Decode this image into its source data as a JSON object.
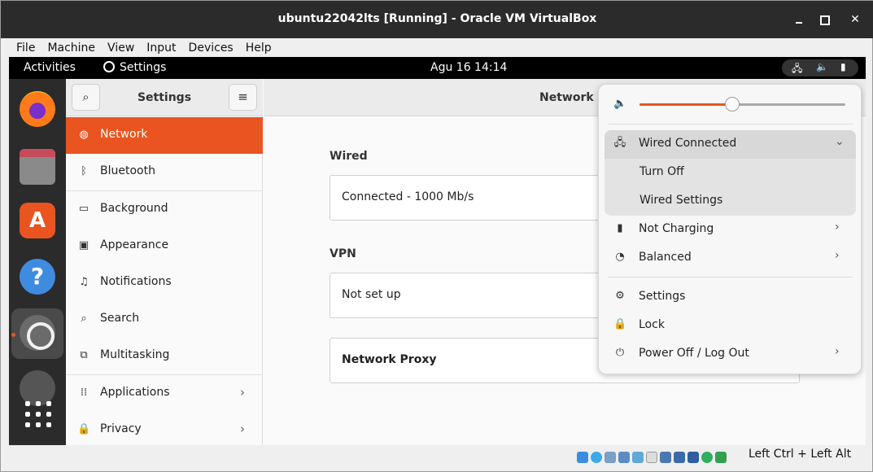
{
  "host": {
    "window_title": "ubuntu22042lts [Running] - Oracle VM VirtualBox",
    "menu": [
      "File",
      "Machine",
      "View",
      "Input",
      "Devices",
      "Help"
    ],
    "host_key": "Left Ctrl + Left Alt"
  },
  "guest": {
    "topbar": {
      "activities": "Activities",
      "app_menu": "Settings",
      "clock": "Agu 16  14:14"
    },
    "dock": [
      "firefox-icon",
      "files-icon",
      "software-icon",
      "help-icon",
      "settings-icon",
      "show-apps-icon"
    ],
    "settings": {
      "sidebar_title": "Settings",
      "nav": [
        {
          "label": "Network",
          "icon": "network-icon",
          "active": true
        },
        {
          "label": "Bluetooth",
          "icon": "bluetooth-icon"
        },
        {
          "label": "Background",
          "icon": "background-icon"
        },
        {
          "label": "Appearance",
          "icon": "appearance-icon"
        },
        {
          "label": "Notifications",
          "icon": "bell-icon"
        },
        {
          "label": "Search",
          "icon": "search-icon"
        },
        {
          "label": "Multitasking",
          "icon": "multitasking-icon"
        },
        {
          "label": "Applications",
          "icon": "grid-icon",
          "arrow": true
        },
        {
          "label": "Privacy",
          "icon": "lock-icon",
          "arrow": true
        }
      ],
      "main_title": "Network",
      "wired_label": "Wired",
      "wired_status": "Connected - 1000 Mb/s",
      "vpn_label": "VPN",
      "vpn_status": "Not set up",
      "proxy_label": "Network Proxy"
    },
    "system_menu": {
      "volume_level": 0.45,
      "wired": "Wired Connected",
      "turn_off": "Turn Off",
      "wired_settings": "Wired Settings",
      "battery": "Not Charging",
      "power_mode": "Balanced",
      "settings": "Settings",
      "lock": "Lock",
      "power": "Power Off / Log Out"
    }
  },
  "colors": {
    "accent": "#e95420",
    "titlebar": "#2b2b2b",
    "topbar": "#000000"
  }
}
